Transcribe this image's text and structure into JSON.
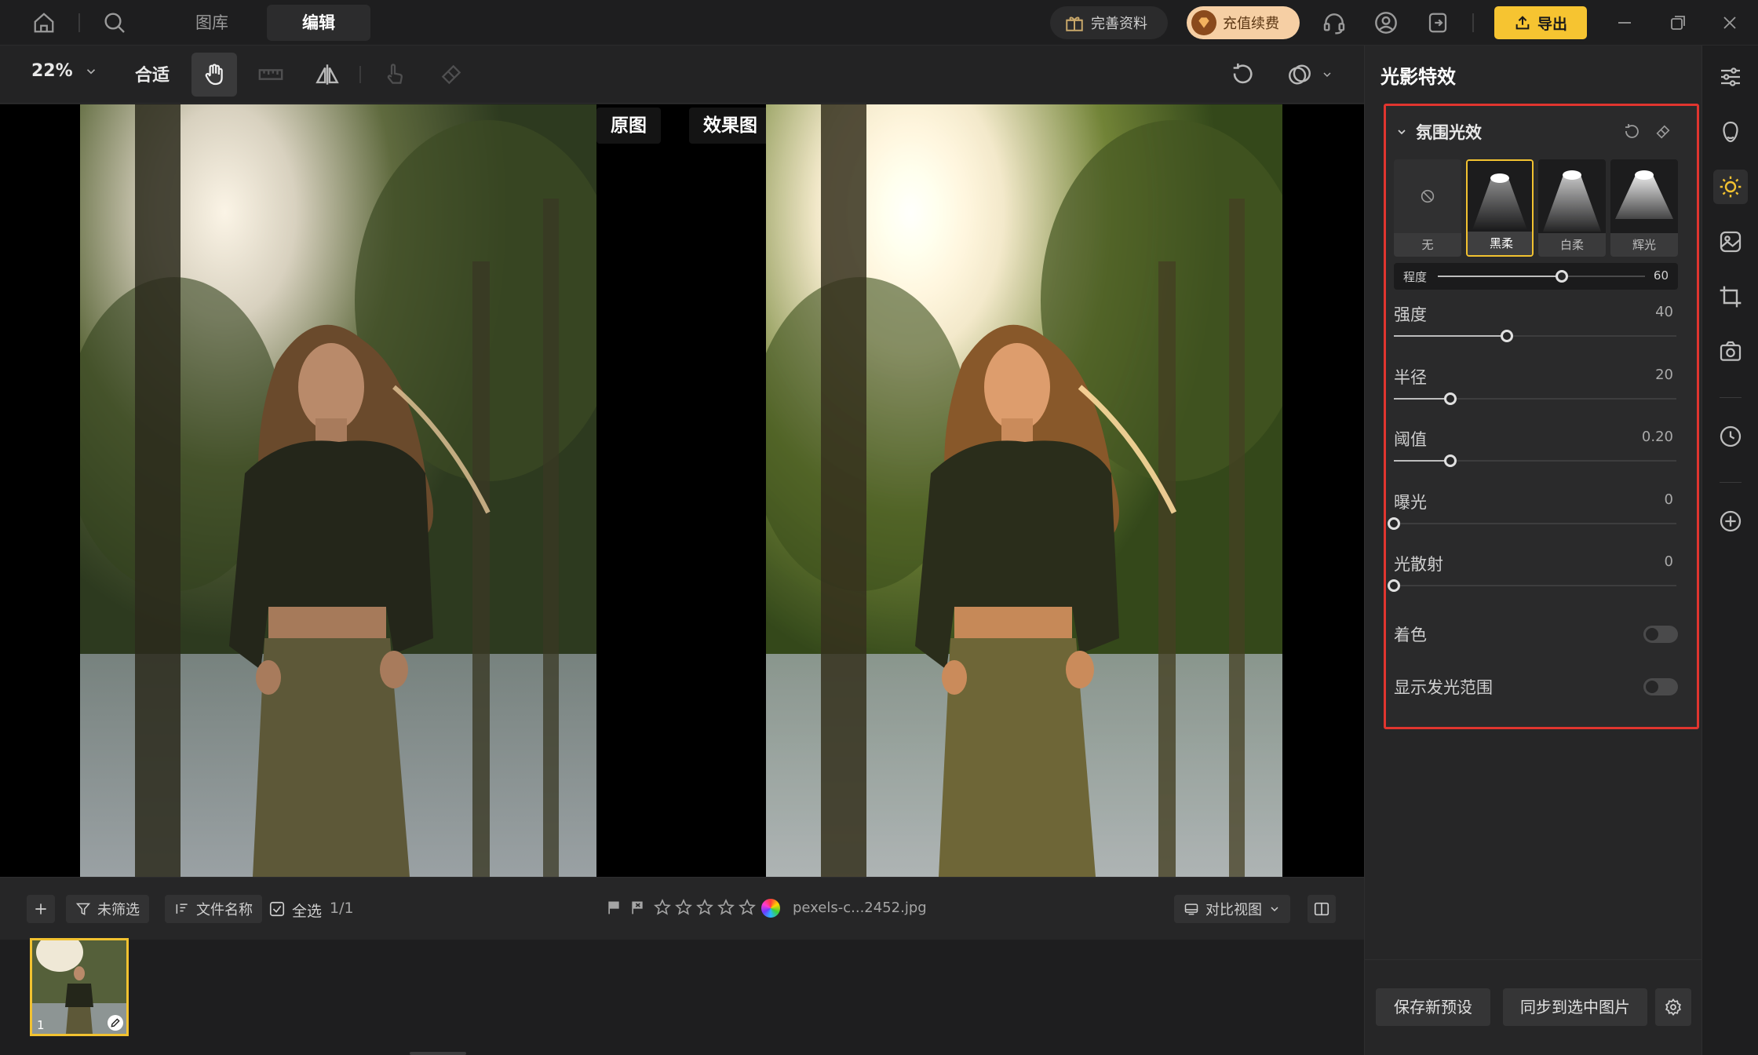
{
  "topbar": {
    "tabs": {
      "library": "图库",
      "edit": "编辑"
    },
    "profile_label": "完善资料",
    "recharge_label": "充值续费",
    "export_label": "导出"
  },
  "toolbar": {
    "zoom": "22%",
    "fit": "合适"
  },
  "canvas": {
    "original_label": "原图",
    "effect_label": "效果图"
  },
  "filmbar": {
    "filter_label": "未筛选",
    "sort_label": "文件名称",
    "select_all_label": "全选",
    "count": "1/1",
    "filename": "pexels-c...2452.jpg",
    "compare_view_label": "对比视图",
    "rating": 0,
    "thumb_index": "1"
  },
  "panel": {
    "title": "光影特效",
    "section": "氛围光效",
    "presets": [
      {
        "label": "无",
        "selected": false
      },
      {
        "label": "黑柔",
        "selected": true
      },
      {
        "label": "白柔",
        "selected": false
      },
      {
        "label": "辉光",
        "selected": false
      }
    ],
    "degree": {
      "label": "程度",
      "value": "60",
      "fraction": 0.6
    },
    "sliders": [
      {
        "label": "强度",
        "value": "40",
        "fraction": 0.4
      },
      {
        "label": "半径",
        "value": "20",
        "fraction": 0.2
      },
      {
        "label": "阈值",
        "value": "0.20",
        "fraction": 0.2
      },
      {
        "label": "曝光",
        "value": "0",
        "fraction": 0
      },
      {
        "label": "光散射",
        "value": "0",
        "fraction": 0
      }
    ],
    "toggles": [
      {
        "label": "着色",
        "on": false
      },
      {
        "label": "显示发光范围",
        "on": false
      }
    ],
    "save_preset": "保存新预设",
    "sync_label": "同步到选中图片"
  },
  "colors": {
    "accent": "#f6c431",
    "highlight_frame": "#e0352f",
    "selection": "#f2c230"
  }
}
